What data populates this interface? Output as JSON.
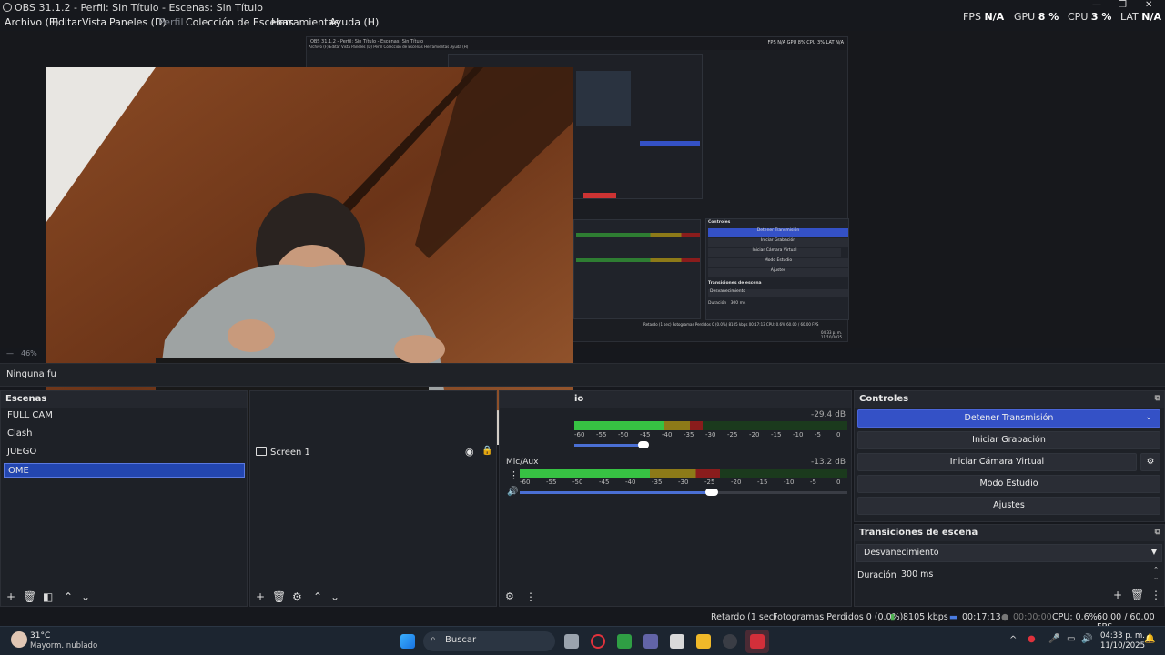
{
  "titlebar": {
    "title": "OBS 31.1.2 - Perfil: Sin Título - Escenas: Sin Título",
    "minimize": "—",
    "maximize": "❐",
    "close": "✕"
  },
  "menu": [
    {
      "label": "Archivo (F)",
      "disabled": false
    },
    {
      "label": "Editar",
      "disabled": false
    },
    {
      "label": "Vista",
      "disabled": false
    },
    {
      "label": "Paneles (D)",
      "disabled": false
    },
    {
      "label": "Perfil",
      "disabled": true
    },
    {
      "label": "Colección de Escenas",
      "disabled": false
    },
    {
      "label": "Herramientas",
      "disabled": false
    },
    {
      "label": "Ayuda (H)",
      "disabled": false
    }
  ],
  "stats": {
    "fps_label": "FPS",
    "fps_value": "N/A",
    "gpu_label": "GPU",
    "gpu_value": "8 %",
    "cpu_label": "CPU",
    "cpu_value": "3 %",
    "lat_label": "LAT",
    "lat_value": "N/A"
  },
  "preview": {
    "zoom": "46%"
  },
  "nested": {
    "title": "OBS 31.1.2 - Perfil: Sin Título - Escenas: Sin Título",
    "menu": "Archivo (F)   Editar   Vista   Paneles (D)   Perfil   Colección de Escenas   Herramientas   Ayuda (H)",
    "stats": "FPS N/A   GPU 8%   CPU 3%   LAT N/A",
    "controls_title": "Controles",
    "btn_stop": "Detener Transmisión",
    "btn_rec": "Iniciar Grabación",
    "btn_vcam": "Iniciar Cámara Virtual",
    "btn_studio": "Modo Estudio",
    "btn_settings": "Ajustes",
    "transitions_title": "Transiciones de escena",
    "transition": "Desvanecimiento",
    "duration_label": "Duración",
    "duration": "300 ms",
    "status": "Retardo (1 sec)   Fotogramas Perdidos 0 (0.0%)   8105 kbps   00:17:13   CPU: 0.6%   60.00 / 60.00 FPS",
    "clock": "04:33 p. m.  11/10/2025"
  },
  "source_bar": {
    "text": "Ninguna fu"
  },
  "scenes": {
    "title": "Escenas",
    "items": [
      {
        "label": "FULL CAM",
        "selected": false
      },
      {
        "label": "Clash",
        "selected": false
      },
      {
        "label": "JUEGO",
        "selected": false
      },
      {
        "label": "OME",
        "selected": true
      }
    ]
  },
  "sources": {
    "items": [
      {
        "label": "Screen 1",
        "visible": true,
        "locked": true
      }
    ]
  },
  "mixer": {
    "title_fragment": "io",
    "channels": [
      {
        "name": "",
        "db": "-29.4 dB",
        "level": 0.47,
        "volume": 0.45
      },
      {
        "name": "Mic/Aux",
        "db": "-13.2 dB",
        "level": 0.61,
        "volume": 0.58
      }
    ],
    "scale": [
      "-60",
      "-55",
      "-50",
      "-45",
      "-40",
      "-35",
      "-30",
      "-25",
      "-20",
      "-15",
      "-10",
      "-5",
      "0"
    ]
  },
  "controls": {
    "title": "Controles",
    "stop_stream": "Detener Transmisión",
    "start_recording": "Iniciar Grabación",
    "start_virtual_cam": "Iniciar Cámara Virtual",
    "studio_mode": "Modo Estudio",
    "settings": "Ajustes"
  },
  "transitions": {
    "title": "Transiciones de escena",
    "selected": "Desvanecimiento",
    "duration_label": "Duración",
    "duration": "300 ms"
  },
  "status": {
    "delay": "Retardo (1 sec)",
    "dropped": "Fotogramas Perdidos 0 (0.0%)",
    "bitrate": "8105 kbps",
    "stream_time": "00:17:13",
    "rec_time": "00:00:00",
    "cpu": "CPU: 0.6%",
    "fps": "60.00 / 60.00 FPS"
  },
  "taskbar": {
    "weather_temp": "31°C",
    "weather_desc": "Mayorm. nublado",
    "search_placeholder": "Buscar",
    "time": "04:33 p. m.",
    "date": "11/10/2025"
  }
}
